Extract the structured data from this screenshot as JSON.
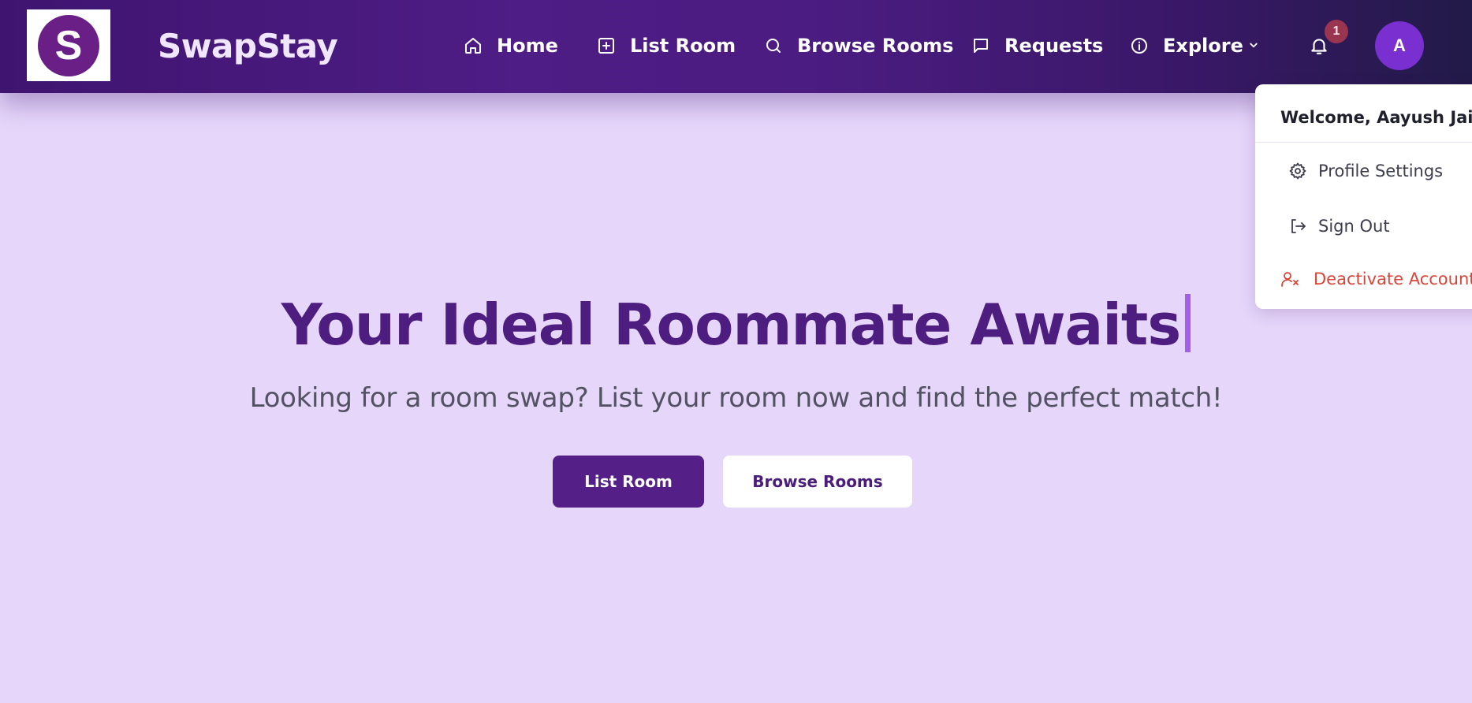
{
  "brand": {
    "name": "SwapStay",
    "logo_letter": "S"
  },
  "nav": {
    "items": [
      {
        "label": "Home",
        "icon": "home-icon"
      },
      {
        "label": "List Room",
        "icon": "plus-square-icon"
      },
      {
        "label": "Browse Rooms",
        "icon": "search-icon"
      },
      {
        "label": "Requests",
        "icon": "message-icon"
      },
      {
        "label": "Explore",
        "icon": "info-icon"
      }
    ],
    "notification_count": "1",
    "avatar_initial": "A"
  },
  "hero": {
    "title": "Your Ideal Roommate Awaits",
    "subtitle": "Looking for a room swap? List your room now and find the perfect match!",
    "primary_button": "List Room",
    "secondary_button": "Browse Rooms"
  },
  "user_menu": {
    "welcome": "Welcome, Aayush Jain",
    "items": [
      {
        "label": "Profile Settings",
        "icon": "gear-icon"
      },
      {
        "label": "Sign Out",
        "icon": "sign-out-icon"
      },
      {
        "label": "Deactivate Account",
        "icon": "user-remove-icon"
      }
    ]
  },
  "colors": {
    "navbar_start": "#3f1470",
    "navbar_end": "#221a48",
    "background": "#e6d6fa",
    "title": "#4e1d80",
    "primary_button": "#551f88",
    "danger": "#d8453a",
    "avatar": "#7a2fd0",
    "badge": "#9a3550"
  }
}
